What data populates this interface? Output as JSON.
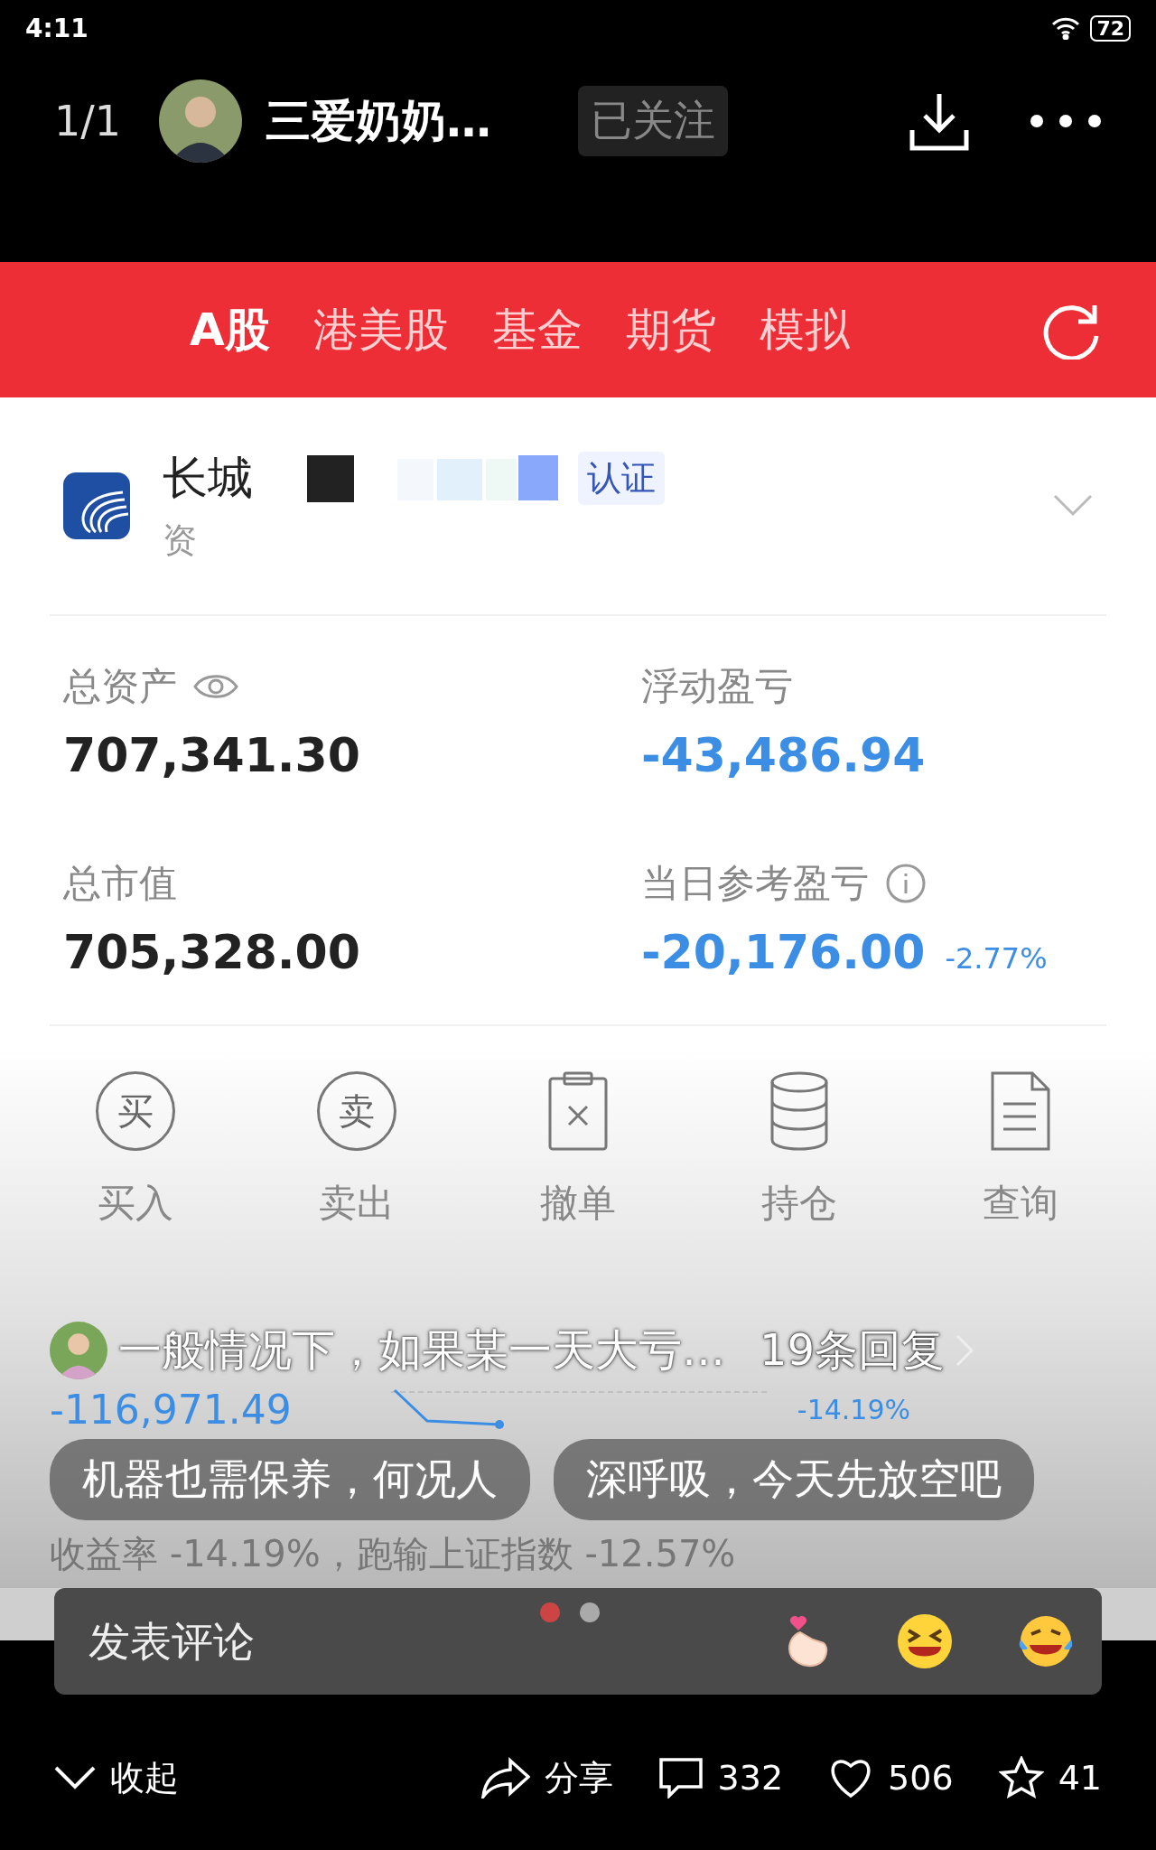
{
  "status_bar": {
    "time": "4:11",
    "battery": "72"
  },
  "header": {
    "page": "1/1",
    "author": "三爱奶奶…",
    "follow": {
      "label": "已关注",
      "selected": true
    }
  },
  "tabs": [
    {
      "label": "A股",
      "selected": true
    },
    {
      "label": "港美股",
      "selected": false
    },
    {
      "label": "基金",
      "selected": false
    },
    {
      "label": "期货",
      "selected": false
    },
    {
      "label": "模拟",
      "selected": false
    }
  ],
  "account": {
    "name": "长城",
    "badge": "认证",
    "subtitle": "资"
  },
  "stats": [
    {
      "label": "总资产",
      "value": "707,341.30",
      "kind": "eye",
      "negative": false
    },
    {
      "label": "浮动盈亏",
      "value": "-43,486.94",
      "negative": true
    },
    {
      "label": "总市值",
      "value": "705,328.00",
      "negative": false
    },
    {
      "label": "当日参考盈亏",
      "value": "-20,176.00",
      "change": "-2.77%",
      "kind": "info",
      "negative": true
    }
  ],
  "actions": [
    {
      "label": "买入",
      "kind": "circle",
      "glyph": "买"
    },
    {
      "label": "卖出",
      "kind": "circle",
      "glyph": "卖"
    },
    {
      "label": "撤单",
      "kind": "clipboard"
    },
    {
      "label": "持仓",
      "kind": "database"
    },
    {
      "label": "查询",
      "kind": "document"
    }
  ],
  "comment": {
    "text": "一般情况下，如果某一天大亏…",
    "replies": "19条回复"
  },
  "underlay": {
    "value": "-116,971.49",
    "chart_label": "-14.19%",
    "summary": "收益率 -14.19%，跑输上证指数 -12.57%"
  },
  "quick_replies": [
    "机器也需保养，何况人",
    "深呼吸，今天先放空吧"
  ],
  "pager": [
    {
      "selected": true
    },
    {
      "selected": false
    }
  ],
  "comment_input": {
    "placeholder": "发表评论"
  },
  "bottom_bar": {
    "collapse": "收起",
    "share": "分享",
    "comments": "332",
    "likes": "506",
    "favorites": "41"
  }
}
